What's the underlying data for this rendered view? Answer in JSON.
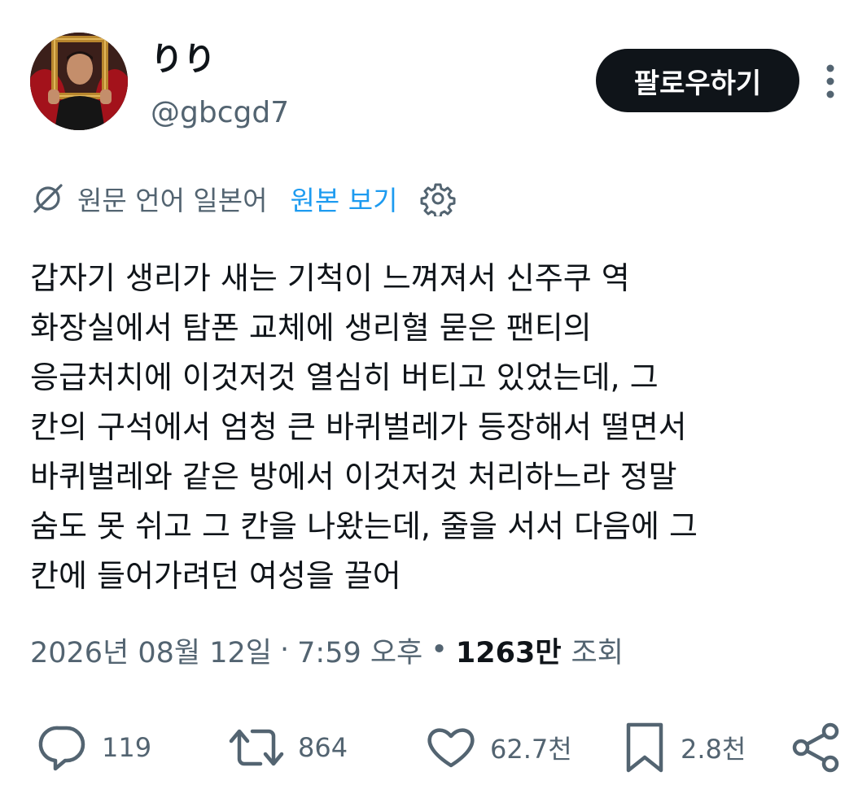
{
  "user": {
    "display_name": "りり",
    "handle": "@gbcgd7",
    "avatar_icon": "avatar-photo-frame"
  },
  "header": {
    "follow_label": "팔로우하기",
    "more_icon": "more-vertical-icon"
  },
  "translation": {
    "icon": "translate-icon",
    "language_label": "원문 언어 일본어",
    "show_original_label": "원본 보기",
    "settings_icon": "gear-icon"
  },
  "tweet": {
    "lines": [
      "갑자기 생리가 새는 기척이 느껴져서 신주쿠 역",
      "화장실에서 탐폰 교체에 생리혈 묻은 팬티의",
      "응급처치에 이것저것 열심히 버티고 있었는데, 그",
      "칸의 구석에서 엄청 큰 바퀴벌레가 등장해서 떨면서",
      "바퀴벌레와 같은 방에서 이것저것 처리하느라 정말",
      "숨도 못 쉬고 그 칸을 나왔는데, 줄을 서서 다음에 그",
      "칸에 들어가려던 여성을 끌어"
    ]
  },
  "meta": {
    "date": "2026년 08월 12일",
    "time": "7:59 오후",
    "separator_1": "·",
    "separator_2": "•",
    "views_count": "1263만",
    "views_label": "조회"
  },
  "actions": {
    "reply": {
      "icon": "reply-icon",
      "count": "119"
    },
    "retweet": {
      "icon": "retweet-icon",
      "count": "864"
    },
    "like": {
      "icon": "heart-icon",
      "count": "62.7천"
    },
    "bookmark": {
      "icon": "bookmark-icon",
      "count": "2.8천"
    },
    "share": {
      "icon": "share-icon"
    }
  },
  "colors": {
    "text_primary": "#0f1419",
    "text_secondary": "#536471",
    "link": "#1d9bf0",
    "button_bg": "#0f1419"
  }
}
